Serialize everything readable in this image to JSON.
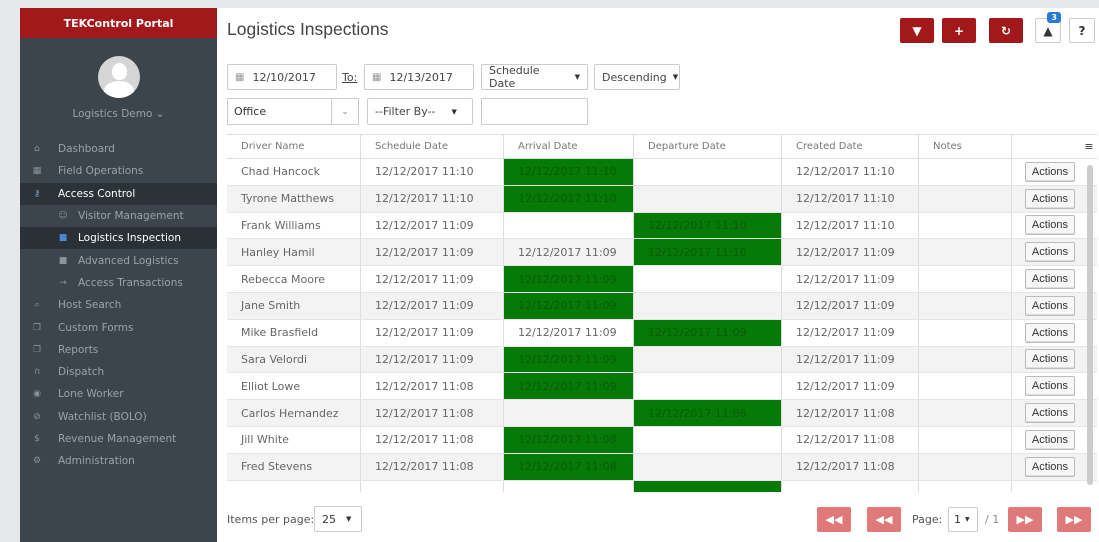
{
  "sidebar": {
    "title": "TEKControl Portal",
    "user": "Logistics Demo ⌄",
    "items": [
      {
        "icon": "home-icon",
        "glyph": "⌂",
        "label": "Dashboard"
      },
      {
        "icon": "grid-icon",
        "glyph": "▦",
        "label": "Field Operations"
      },
      {
        "icon": "key-icon",
        "glyph": "⚷",
        "label": "Access Control"
      },
      {
        "icon": "person-icon",
        "glyph": "☺",
        "label": "Visitor Management"
      },
      {
        "icon": "truck-icon",
        "glyph": "■",
        "label": "Logistics Inspection"
      },
      {
        "icon": "truck-icon",
        "glyph": "■",
        "label": "Advanced Logistics"
      },
      {
        "icon": "sign-in-icon",
        "glyph": "→",
        "label": "Access Transactions"
      },
      {
        "icon": "search-icon",
        "glyph": "⌕",
        "label": "Host Search"
      },
      {
        "icon": "copy-icon",
        "glyph": "❐",
        "label": "Custom Forms"
      },
      {
        "icon": "copy-icon",
        "glyph": "❐",
        "label": "Reports"
      },
      {
        "icon": "headset-icon",
        "glyph": "∩",
        "label": "Dispatch"
      },
      {
        "icon": "eye-icon",
        "glyph": "◉",
        "label": "Lone Worker"
      },
      {
        "icon": "ban-icon",
        "glyph": "⊘",
        "label": "Watchlist (BOLO)"
      },
      {
        "icon": "dollar-icon",
        "glyph": "$",
        "label": "Revenue Management"
      },
      {
        "icon": "cogs-icon",
        "glyph": "⚙",
        "label": "Administration"
      }
    ]
  },
  "header": {
    "title": "Logistics Inspections",
    "notification_count": "3",
    "help_label": "?"
  },
  "filters": {
    "from_date": "12/10/2017",
    "to_label": "To:",
    "to_date": "12/13/2017",
    "sort_field": "Schedule Date",
    "sort_order": "Descending",
    "office": "Office",
    "filter_by": "--Filter By--",
    "filter_value": ""
  },
  "table": {
    "columns": [
      "Driver Name",
      "Schedule Date",
      "Arrival Date",
      "Departure Date",
      "Created Date",
      "Notes"
    ],
    "action_label": "Actions",
    "rows": [
      {
        "driver": "Chad Hancock",
        "schedule": "12/12/2017 11:10",
        "arrival": "12/12/2017 11:10",
        "arrival_green": true,
        "departure": "",
        "departure_green": false,
        "created": "12/12/2017 11:10",
        "notes": ""
      },
      {
        "driver": "Tyrone Matthews",
        "schedule": "12/12/2017 11:10",
        "arrival": "12/12/2017 11:10",
        "arrival_green": true,
        "departure": "",
        "departure_green": false,
        "created": "12/12/2017 11:10",
        "notes": ""
      },
      {
        "driver": "Frank Williams",
        "schedule": "12/12/2017 11:09",
        "arrival": "",
        "arrival_green": false,
        "departure": "12/12/2017 11:10",
        "departure_green": true,
        "created": "12/12/2017 11:10",
        "notes": ""
      },
      {
        "driver": "Hanley Hamil",
        "schedule": "12/12/2017 11:09",
        "arrival": "12/12/2017 11:09",
        "arrival_green": false,
        "departure": "12/12/2017 11:10",
        "departure_green": true,
        "created": "12/12/2017 11:09",
        "notes": ""
      },
      {
        "driver": "Rebecca Moore",
        "schedule": "12/12/2017 11:09",
        "arrival": "12/12/2017 11:09",
        "arrival_green": true,
        "departure": "",
        "departure_green": false,
        "created": "12/12/2017 11:09",
        "notes": ""
      },
      {
        "driver": "Jane Smith",
        "schedule": "12/12/2017 11:09",
        "arrival": "12/12/2017 11:09",
        "arrival_green": true,
        "departure": "",
        "departure_green": false,
        "created": "12/12/2017 11:09",
        "notes": ""
      },
      {
        "driver": "Mike Brasfield",
        "schedule": "12/12/2017 11:09",
        "arrival": "12/12/2017 11:09",
        "arrival_green": false,
        "departure": "12/12/2017 11:09",
        "departure_green": true,
        "created": "12/12/2017 11:09",
        "notes": ""
      },
      {
        "driver": "Sara Velordi",
        "schedule": "12/12/2017 11:09",
        "arrival": "12/12/2017 11:09",
        "arrival_green": true,
        "departure": "",
        "departure_green": false,
        "created": "12/12/2017 11:09",
        "notes": ""
      },
      {
        "driver": "Elliot Lowe",
        "schedule": "12/12/2017 11:08",
        "arrival": "12/12/2017 11:09",
        "arrival_green": true,
        "departure": "",
        "departure_green": false,
        "created": "12/12/2017 11:09",
        "notes": ""
      },
      {
        "driver": "Carlos Hernandez",
        "schedule": "12/12/2017 11:08",
        "arrival": "",
        "arrival_green": false,
        "departure": "12/12/2017 11:08",
        "departure_green": true,
        "created": "12/12/2017 11:08",
        "notes": ""
      },
      {
        "driver": "Jill White",
        "schedule": "12/12/2017 11:08",
        "arrival": "12/12/2017 11:08",
        "arrival_green": true,
        "departure": "",
        "departure_green": false,
        "created": "12/12/2017 11:08",
        "notes": ""
      },
      {
        "driver": "Fred Stevens",
        "schedule": "12/12/2017 11:08",
        "arrival": "12/12/2017 11:08",
        "arrival_green": true,
        "departure": "",
        "departure_green": false,
        "created": "12/12/2017 11:08",
        "notes": ""
      },
      {
        "driver": "",
        "schedule": "",
        "arrival": "",
        "arrival_green": false,
        "departure": "",
        "departure_green": true,
        "created": "",
        "notes": ""
      }
    ]
  },
  "footer": {
    "items_per_page_label": "Items per page:",
    "items_per_page": "25",
    "page_label": "Page:",
    "page": "1",
    "page_total": "/ 1"
  },
  "colors": {
    "brand": "#a3191b",
    "sidebar": "#3c444c",
    "arrived": "#067a06",
    "pager": "#e07a7a"
  }
}
